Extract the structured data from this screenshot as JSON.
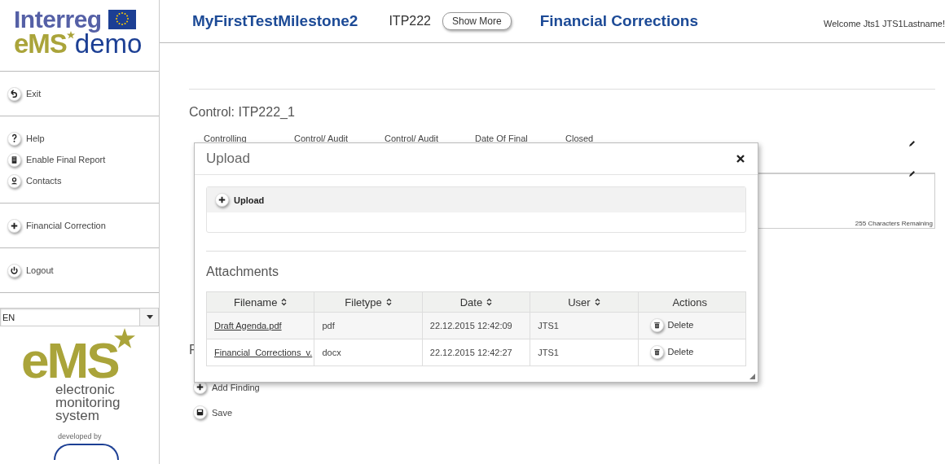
{
  "logo": {
    "line_1": "Interreg",
    "accent": "eMS",
    "line_2": "demo"
  },
  "header": {
    "project": "MyFirstTestMilestone2",
    "code": "ITP222",
    "show_more": "Show More",
    "page_title": "Financial Corrections",
    "welcome": "Welcome Jts1 JTS1Lastname!"
  },
  "sidebar": {
    "groups": [
      [
        {
          "kind": "back",
          "label": "Exit"
        }
      ],
      [
        {
          "kind": "help",
          "label": "Help"
        },
        {
          "kind": "book",
          "label": "Enable Final Report"
        },
        {
          "kind": "person",
          "label": "Contacts"
        }
      ],
      [
        {
          "kind": "plus",
          "label": "Financial Correction"
        }
      ],
      [
        {
          "kind": "power",
          "label": "Logout"
        }
      ]
    ],
    "language": "EN",
    "brand": {
      "mark": "eMS",
      "tagline": [
        "electronic",
        "monitoring",
        "system"
      ],
      "developed_by": "developed by"
    }
  },
  "control": {
    "title": "Control: ITP222_1",
    "columns": [
      "Controlling",
      "Control/ Audit",
      "Control/ Audit",
      "Date Of Final",
      "Closed"
    ],
    "characters_remaining": "255 Characters Remaining",
    "findings_heading": "F",
    "actions": [
      {
        "kind": "plus",
        "label": "Add Finding"
      },
      {
        "kind": "save",
        "label": "Save"
      }
    ]
  },
  "dialog": {
    "title": "Upload",
    "upload_button": "Upload",
    "attachments_heading": "Attachments",
    "columns": [
      {
        "label": "Filename",
        "sortable": true
      },
      {
        "label": "Filetype",
        "sortable": true
      },
      {
        "label": "Date",
        "sortable": true
      },
      {
        "label": "User",
        "sortable": true
      },
      {
        "label": "Actions",
        "sortable": false
      }
    ],
    "rows": [
      {
        "filename": "Draft Agenda.pdf",
        "filetype": "pdf",
        "date": "22.12.2015 12:42:09",
        "user": "JTS1",
        "action": "Delete"
      },
      {
        "filename": "Financial_Corrections_v.",
        "filetype": "docx",
        "date": "22.12.2015 12:42:27",
        "user": "JTS1",
        "action": "Delete"
      }
    ]
  }
}
